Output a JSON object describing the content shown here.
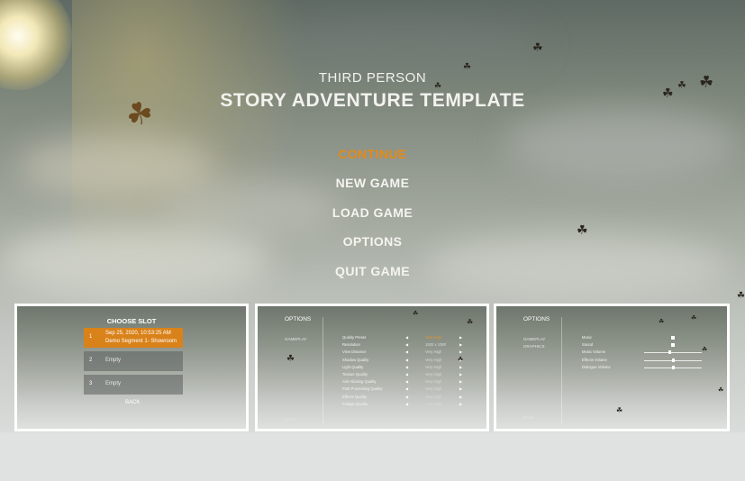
{
  "header": {
    "subtitle": "THIRD PERSON",
    "title": "STORY ADVENTURE TEMPLATE"
  },
  "menu": {
    "items": [
      {
        "label": "CONTINUE",
        "active": true
      },
      {
        "label": "NEW GAME",
        "active": false
      },
      {
        "label": "LOAD GAME",
        "active": false
      },
      {
        "label": "OPTIONS",
        "active": false
      },
      {
        "label": "QUIT GAME",
        "active": false
      }
    ]
  },
  "colors": {
    "accent": "#e58a16",
    "text": "#f4f4f0"
  },
  "thumb_choose_slot": {
    "title": "CHOOSE SLOT",
    "slots": [
      {
        "number": "1",
        "line1": "Sep 25, 2020, 10:53:25 AM",
        "line2": "Demo Segment 1- Showroom",
        "selected": true
      },
      {
        "number": "2",
        "line1": "Empty",
        "selected": false
      },
      {
        "number": "3",
        "line1": "Empty",
        "selected": false
      }
    ],
    "back": "BACK"
  },
  "thumb_graphics": {
    "heading": "OPTIONS",
    "sidebar": [
      "GAMEPLAY"
    ],
    "rows": [
      {
        "label": "Quality Preset",
        "value": "Very High"
      },
      {
        "label": "Resolution",
        "value": "1920 x 1080"
      },
      {
        "label": "View Distance",
        "value": "Very High"
      },
      {
        "label": "Shadow Quality",
        "value": "Very High"
      },
      {
        "label": "Light Quality",
        "value": "Very High"
      },
      {
        "label": "Texture Quality",
        "value": "Very High"
      },
      {
        "label": "Anti-Aliasing Quality",
        "value": "Very High"
      },
      {
        "label": "Post Processing Quality",
        "value": "Very High"
      },
      {
        "label": "Effects Quality",
        "value": "Very High"
      },
      {
        "label": "Foliage Quality",
        "value": "Very High"
      }
    ],
    "back": "BACK"
  },
  "thumb_audio": {
    "heading": "OPTIONS",
    "sidebar": [
      "GAMEPLAY",
      "GRAPHICS"
    ],
    "rows": [
      {
        "label": "Music",
        "kind": "checkbox",
        "checked": true
      },
      {
        "label": "Sound",
        "kind": "checkbox",
        "checked": true
      },
      {
        "label": "Music Volume",
        "kind": "slider",
        "level": 0.45
      },
      {
        "label": "Effects Volume",
        "kind": "slider",
        "level": 0.5
      },
      {
        "label": "Dialogue Volume",
        "kind": "slider",
        "level": 0.5
      }
    ],
    "back": "BACK"
  }
}
